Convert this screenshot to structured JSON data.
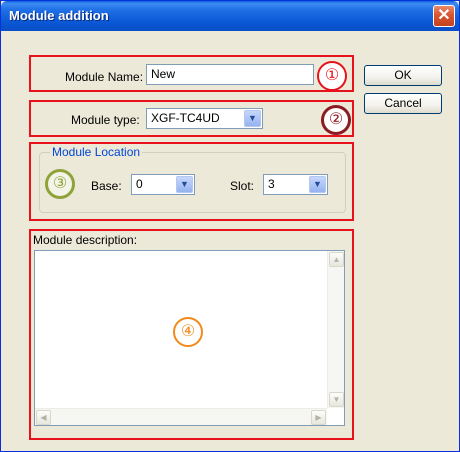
{
  "window": {
    "title": "Module addition",
    "close_glyph": "✕"
  },
  "form": {
    "module_name_label": "Module Name:",
    "module_name_value": "New",
    "module_type_label": "Module type:",
    "module_type_value": "XGF-TC4UD",
    "location_group_label": "Module Location",
    "base_label": "Base:",
    "base_value": "0",
    "slot_label": "Slot:",
    "slot_value": "3",
    "description_label": "Module description:",
    "description_value": ""
  },
  "buttons": {
    "ok": "OK",
    "cancel": "Cancel"
  },
  "annotations": {
    "one": "①",
    "two": "②",
    "three": "③",
    "four": "④",
    "colors": {
      "one": "#e8121c",
      "two": "#8c1a1f",
      "three": "#8fa33a",
      "four": "#f08a1c",
      "highlight_box": "#e8121c"
    }
  },
  "icons": {
    "combo_arrow": "chevron-down-icon",
    "scroll_up": "chevron-up-icon",
    "scroll_down": "chevron-down-icon",
    "scroll_left": "chevron-left-icon",
    "scroll_right": "chevron-right-icon",
    "close": "close-icon"
  }
}
